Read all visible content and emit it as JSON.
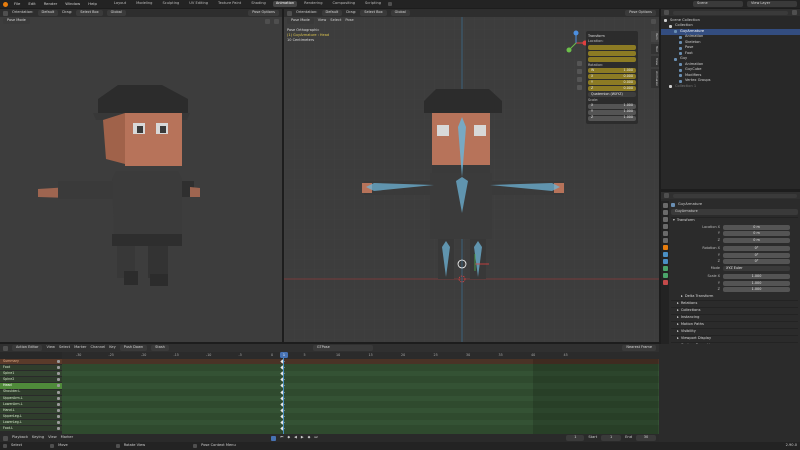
{
  "topbar": {
    "menus": [
      "File",
      "Edit",
      "Render",
      "Window",
      "Help"
    ],
    "workspaces": [
      "Layout",
      "Modeling",
      "Sculpting",
      "UV Editing",
      "Texture Paint",
      "Shading",
      "Animation",
      "Rendering",
      "Compositing",
      "Scripting"
    ],
    "active_workspace": "Animation",
    "scene": "Scene",
    "view_layer": "View Layer"
  },
  "left_viewport": {
    "mode": "Pose Mode",
    "orientation_label": "Orientation:",
    "orientation": "Default",
    "drag_label": "Drag:",
    "drag": "Select Box",
    "pivot": "Global",
    "pose_options": "Pose Options"
  },
  "right_viewport": {
    "orientation_label": "Orientation:",
    "orientation": "Default",
    "drag_label": "Drag:",
    "drag": "Select Box",
    "pivot": "Global",
    "pose_options": "Pose Options",
    "mode": "Pose Mode",
    "menus": [
      "View",
      "Select",
      "Pose"
    ],
    "info_line1": "Pose Orthographic",
    "info_line2": "(1) GuyArmature : Head",
    "info_line3": "10 Centimeters"
  },
  "npanel": {
    "title": "Transform",
    "location_label": "Location:",
    "rotation_label": "Rotation:",
    "rotation": [
      {
        "axis": "W",
        "value": "1.000"
      },
      {
        "axis": "X",
        "value": "0.000"
      },
      {
        "axis": "Y",
        "value": "0.000"
      },
      {
        "axis": "Z",
        "value": "0.000"
      }
    ],
    "rotation_mode": "Quaternion (WXYZ)",
    "scale_label": "Scale:",
    "scale": [
      {
        "axis": "X",
        "value": "1.000"
      },
      {
        "axis": "Y",
        "value": "1.000"
      },
      {
        "axis": "Z",
        "value": "1.000"
      }
    ],
    "tabs": [
      "Item",
      "Tool",
      "View",
      "Animation"
    ]
  },
  "outliner": {
    "items": [
      {
        "label": "Scene Collection",
        "indent": 0,
        "color": "#cfcfcf"
      },
      {
        "label": "Collection",
        "indent": 1,
        "color": "#cfcfcf"
      },
      {
        "label": "GuyArmature",
        "indent": 2,
        "color": "#ffffff",
        "selected": true
      },
      {
        "label": "Animation",
        "indent": 3,
        "color": "#cfcfcf"
      },
      {
        "label": "Skeleton",
        "indent": 3,
        "color": "#cfcfcf"
      },
      {
        "label": "Pose",
        "indent": 3,
        "color": "#cfcfcf"
      },
      {
        "label": "Foot",
        "indent": 3,
        "color": "#cfcfcf"
      },
      {
        "label": "Guy",
        "indent": 2,
        "color": "#cfcfcf"
      },
      {
        "label": "Animation",
        "indent": 3,
        "color": "#cfcfcf"
      },
      {
        "label": "GuyCube",
        "indent": 3,
        "color": "#cfcfcf"
      },
      {
        "label": "Modifiers",
        "indent": 3,
        "color": "#cfcfcf"
      },
      {
        "label": "Vertex Groups",
        "indent": 3,
        "color": "#cfcfcf"
      },
      {
        "label": "Collection 1",
        "indent": 1,
        "color": "#777777"
      }
    ]
  },
  "properties": {
    "object_name": "GuyArmature",
    "object_name_field": "GuyArmature",
    "transform_section": "Transform",
    "location_rows": [
      {
        "label": "Location X",
        "value": "0 m"
      },
      {
        "label": "Y",
        "value": "0 m"
      },
      {
        "label": "Z",
        "value": "0 m"
      }
    ],
    "rotation_rows": [
      {
        "label": "Rotation X",
        "value": "0°"
      },
      {
        "label": "Y",
        "value": "0°"
      },
      {
        "label": "Z",
        "value": "0°"
      }
    ],
    "mode_label": "Mode",
    "mode_value": "XYZ Euler",
    "scale_rows": [
      {
        "label": "Scale X",
        "value": "1.000"
      },
      {
        "label": "Y",
        "value": "1.000"
      },
      {
        "label": "Z",
        "value": "1.000"
      }
    ],
    "delta_transform": "Delta Transform",
    "sections": [
      "Relations",
      "Collections",
      "Instancing",
      "Motion Paths",
      "Visibility",
      "Viewport Display",
      "Custom Properties"
    ]
  },
  "dopesheet": {
    "editor": "Action Editor",
    "menus": [
      "View",
      "Select",
      "Marker",
      "Channel",
      "Key"
    ],
    "push_down": "Push Down",
    "stash": "Stash",
    "action": "GTPose",
    "snap": "Nearest Frame",
    "ruler_ticks": [
      "-30",
      "-25",
      "-20",
      "-15",
      "-10",
      "-5",
      "0",
      "5",
      "10",
      "15",
      "20",
      "25",
      "30",
      "35",
      "40",
      "45"
    ],
    "current_frame": "1",
    "channels": [
      "Summary",
      "Foot",
      "Spine1",
      "Spine2",
      "Head",
      "Shoulder.L",
      "UpperArm.L",
      "LowerArm.L",
      "Hand.L",
      "UpperLeg.L",
      "LowerLeg.L",
      "Foot.L"
    ]
  },
  "playback": {
    "menus": [
      "Playback",
      "Keying",
      "View",
      "Marker"
    ],
    "start_label": "Start",
    "start": "1",
    "end_label": "End",
    "end": "30",
    "frame": "1"
  },
  "statusbar": {
    "items": [
      "Select",
      "Move",
      "Rotate View",
      "Pose Context Menu"
    ],
    "version": "2.90.0"
  },
  "colors": {
    "accent": "#4772b3",
    "select_yellow": "#8c7b24",
    "key_green": "#3d5a3a",
    "bone_blue": "#6db3d6"
  }
}
